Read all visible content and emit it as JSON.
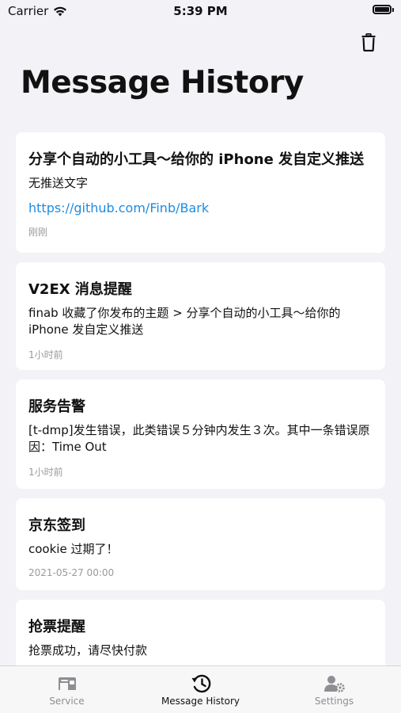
{
  "status_bar": {
    "carrier": "Carrier",
    "time": "5:39 PM",
    "battery_level": 1.0
  },
  "header": {
    "title": "Message History",
    "delete_icon": "trash-icon"
  },
  "messages": [
    {
      "title": "分享个自动的小工具～给你的 iPhone 发自定义推送",
      "body": "无推送文字",
      "link": "https://github.com/Finb/Bark",
      "time": "刚刚"
    },
    {
      "title": "V2EX 消息提醒",
      "body": "finab 收藏了你发布的主题 > 分享个自动的小工具～给你的 iPhone 发自定义推送",
      "time": "1小时前"
    },
    {
      "title": "服务告警",
      "body": "[t-dmp]发生错误，此类错误５分钟内发生３次。其中一条错误原因：Time Out",
      "time": "1小时前"
    },
    {
      "title": "京东签到",
      "body": "cookie 过期了！",
      "time": "2021-05-27 00:00"
    },
    {
      "title": "抢票提醒",
      "body": "抢票成功，请尽快付款"
    }
  ],
  "tabbar": {
    "tabs": [
      {
        "label": "Service",
        "icon": "service-icon",
        "active": false
      },
      {
        "label": "Message History",
        "icon": "history-icon",
        "active": true
      },
      {
        "label": "Settings",
        "icon": "settings-icon",
        "active": false
      }
    ]
  },
  "colors": {
    "background": "#f2f2f7",
    "card": "#ffffff",
    "link": "#1d8ce0",
    "secondary_text": "#9a9a9f",
    "tab_active": "#111111",
    "tab_inactive": "#8e8e93"
  }
}
